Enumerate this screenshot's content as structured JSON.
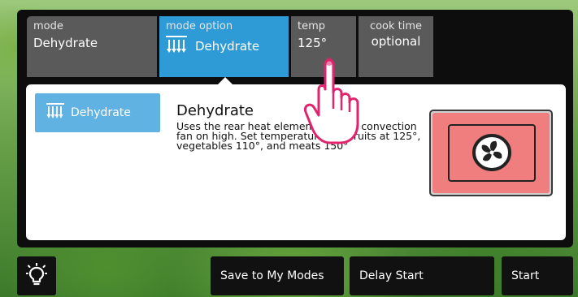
{
  "tabs": {
    "mode": {
      "label": "mode",
      "value": "Dehydrate"
    },
    "mode_option": {
      "label": "mode option",
      "value": "Dehydrate"
    },
    "temp": {
      "label": "temp",
      "value": "125°"
    },
    "cook_time": {
      "label": "cook time",
      "value": "optional"
    }
  },
  "selected_mode_button": {
    "label": "Dehydrate"
  },
  "detail": {
    "title": "Dehydrate",
    "description": "Uses the rear heat element and the convection fan on high. Set temperatures for fruits at 125°, vegetables 110°, and meats 150°"
  },
  "bottom_bar": {
    "save_label": "Save to My Modes",
    "delay_label": "Delay Start",
    "start_label": "Start"
  },
  "colors": {
    "accent_blue": "#2f9bd6",
    "mode_button_blue": "#5fb2e2",
    "oven_red": "#f07e7e",
    "tab_gray": "#5a5a5a",
    "touch_hand": "#e0246e"
  },
  "icons": [
    "dehydrate-element-icon",
    "convection-fan-icon",
    "light-bulb-icon",
    "touch-hand-icon"
  ]
}
